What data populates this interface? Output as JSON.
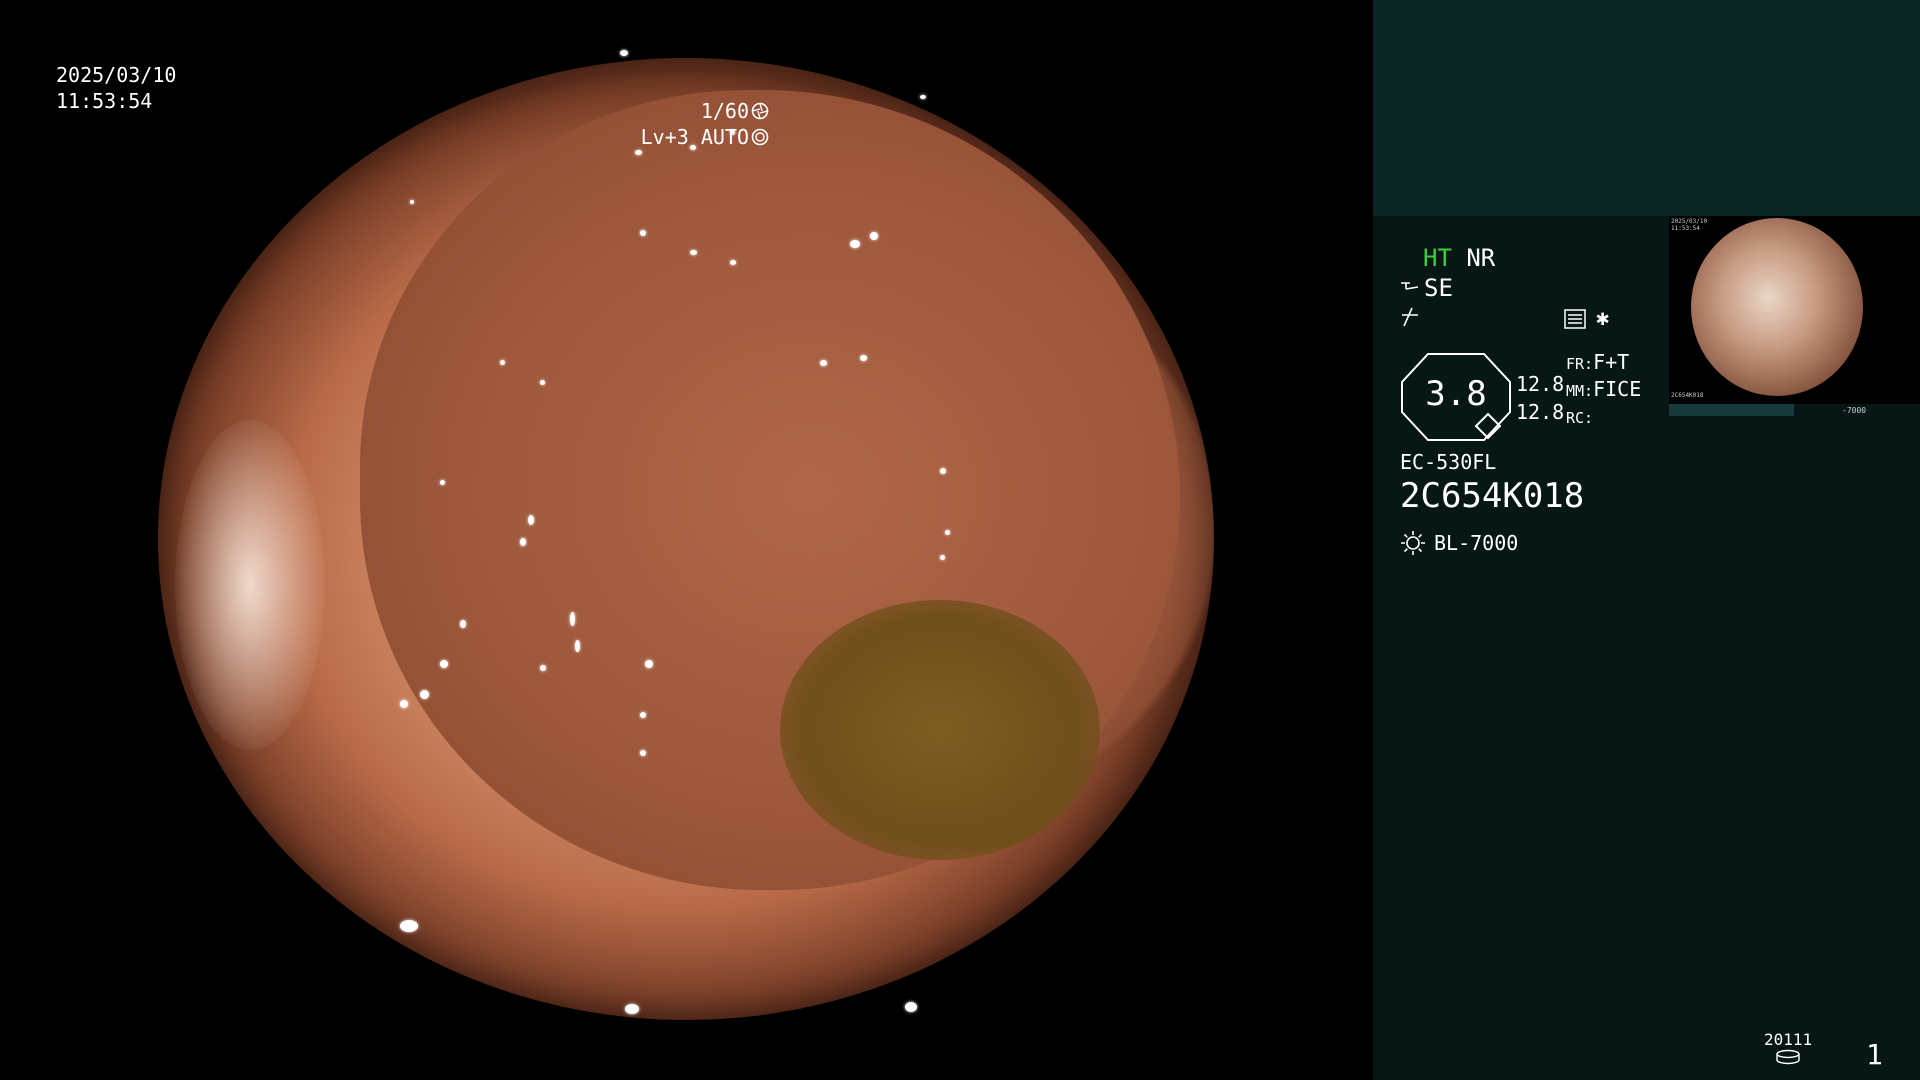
{
  "overlay": {
    "date": "2025/03/10",
    "time": "11:53:54",
    "shutter": "1/60",
    "level": "Lv+3 AUTO"
  },
  "panel": {
    "ht_label": "HT",
    "nr_label": "NR",
    "se_label": "SE",
    "zoom_value": "3.8",
    "zoom_line1": "12.8",
    "zoom_line2": "12.8",
    "fr_key": "FR:",
    "fr_val": "F+T",
    "mm_key": "MM:",
    "mm_val": "FICE",
    "rc_key": "RC:",
    "rc_val": "",
    "scope_model": "EC-530FL",
    "scope_serial": "2C654K018",
    "light_source": "BL-7000",
    "storage_count": "20111",
    "page_number": "1",
    "thumb_id": "2C654K018",
    "thumb_info": "-7000"
  },
  "colors": {
    "ht_green": "#39d23a",
    "panel_bg": "#061716",
    "panel_top": "#0b2524"
  },
  "icons": {
    "shutter": "aperture-icon",
    "auto": "iris-icon",
    "se": "scope-icon",
    "flag": "strike-icon",
    "mode": "settings-list-icon",
    "light": "lamp-icon",
    "storage": "disk-icon"
  }
}
